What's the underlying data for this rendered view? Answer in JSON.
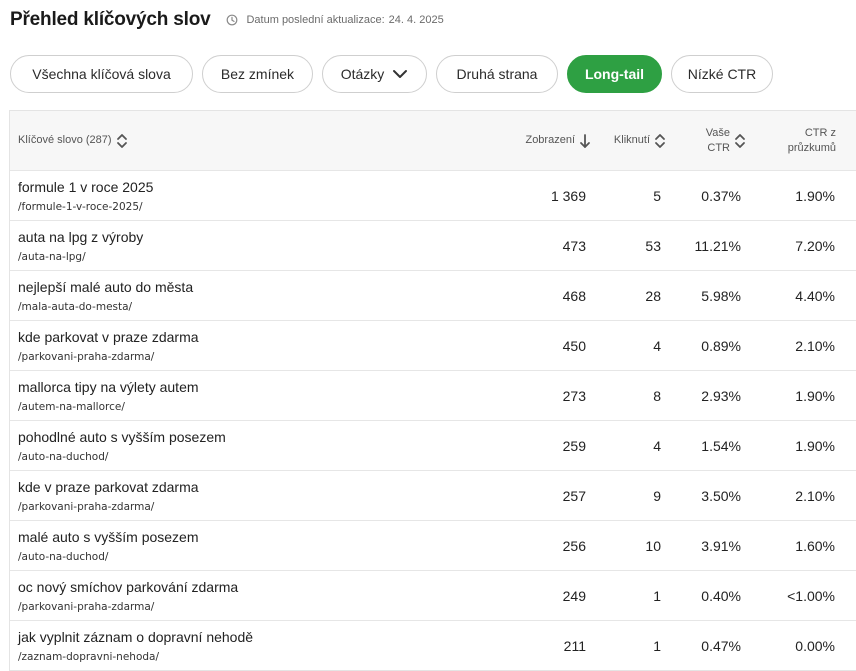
{
  "header": {
    "title": "Přehled klíčových slov",
    "updated_label": "Datum poslední aktualizace:",
    "updated_date": "24. 4. 2025"
  },
  "filters": [
    {
      "label": "Všechna klíčová slova",
      "active": false
    },
    {
      "label": "Bez zmínek",
      "active": false
    },
    {
      "label": "Otázky",
      "active": false,
      "dropdown": true
    },
    {
      "label": "Druhá strana",
      "active": false
    },
    {
      "label": "Long-tail",
      "active": true
    },
    {
      "label": "Nízké CTR",
      "active": false
    }
  ],
  "colors": {
    "accent": "#2ea043",
    "header_bg": "#f7f7f7",
    "border": "#e6e6e6"
  },
  "table": {
    "columns": {
      "keyword": "Klíčové slovo (287)",
      "impressions": "Zobrazení",
      "clicks": "Kliknutí",
      "ctr_line1": "Vaše",
      "ctr_line2": "CTR",
      "bench_line1": "CTR z",
      "bench_line2": "průzkumů"
    },
    "sort": {
      "column": "impressions",
      "direction": "desc"
    },
    "rows": [
      {
        "keyword": "formule 1 v roce 2025",
        "url": "/formule-1-v-roce-2025/",
        "impressions": "1 369",
        "clicks": "5",
        "ctr": "0.37%",
        "bench": "1.90%"
      },
      {
        "keyword": "auta na lpg z výroby",
        "url": "/auta-na-lpg/",
        "impressions": "473",
        "clicks": "53",
        "ctr": "11.21%",
        "bench": "7.20%"
      },
      {
        "keyword": "nejlepší malé auto do města",
        "url": "/mala-auta-do-mesta/",
        "impressions": "468",
        "clicks": "28",
        "ctr": "5.98%",
        "bench": "4.40%"
      },
      {
        "keyword": "kde parkovat v praze zdarma",
        "url": "/parkovani-praha-zdarma/",
        "impressions": "450",
        "clicks": "4",
        "ctr": "0.89%",
        "bench": "2.10%"
      },
      {
        "keyword": "mallorca tipy na výlety autem",
        "url": "/autem-na-mallorce/",
        "impressions": "273",
        "clicks": "8",
        "ctr": "2.93%",
        "bench": "1.90%"
      },
      {
        "keyword": "pohodlné auto s vyšším posezem",
        "url": "/auto-na-duchod/",
        "impressions": "259",
        "clicks": "4",
        "ctr": "1.54%",
        "bench": "1.90%"
      },
      {
        "keyword": "kde v praze parkovat zdarma",
        "url": "/parkovani-praha-zdarma/",
        "impressions": "257",
        "clicks": "9",
        "ctr": "3.50%",
        "bench": "2.10%"
      },
      {
        "keyword": "malé auto s vyšším posezem",
        "url": "/auto-na-duchod/",
        "impressions": "256",
        "clicks": "10",
        "ctr": "3.91%",
        "bench": "1.60%"
      },
      {
        "keyword": "oc nový smíchov parkování zdarma",
        "url": "/parkovani-praha-zdarma/",
        "impressions": "249",
        "clicks": "1",
        "ctr": "0.40%",
        "bench": "<1.00%"
      },
      {
        "keyword": "jak vyplnit záznam o dopravní nehodě",
        "url": "/zaznam-dopravni-nehoda/",
        "impressions": "211",
        "clicks": "1",
        "ctr": "0.47%",
        "bench": "0.00%"
      }
    ]
  }
}
